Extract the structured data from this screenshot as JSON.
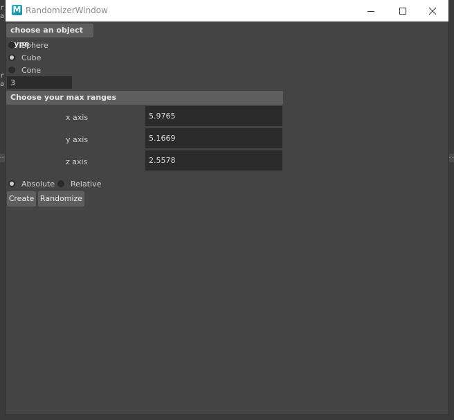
{
  "window": {
    "title": "RandomizerWindow",
    "icon_letter": "M",
    "icon": "maya-app-icon",
    "controls": [
      "minimize-icon",
      "maximize-icon",
      "close-icon"
    ]
  },
  "object_type": {
    "header": "choose an object type",
    "options": [
      {
        "label": "Sphere",
        "checked": false
      },
      {
        "label": "Cube",
        "checked": true
      },
      {
        "label": "Cone",
        "checked": false
      }
    ],
    "count_value": "3"
  },
  "ranges": {
    "header": "Choose your max ranges",
    "axes": [
      {
        "label": "x axis",
        "value": "5.9765"
      },
      {
        "label": "y axis",
        "value": "5.1669"
      },
      {
        "label": "z axis",
        "value": "2.5578"
      }
    ]
  },
  "mode": {
    "options": [
      {
        "label": "Absolute",
        "checked": true
      },
      {
        "label": "Relative",
        "checked": false
      }
    ]
  },
  "buttons": {
    "create": "Create",
    "randomize": "Randomize"
  },
  "colors": {
    "window_bg": "#444444",
    "header_bg": "#5e5e5e",
    "field_bg": "#2b2b2b",
    "titlebar_bg": "#ffffff"
  }
}
